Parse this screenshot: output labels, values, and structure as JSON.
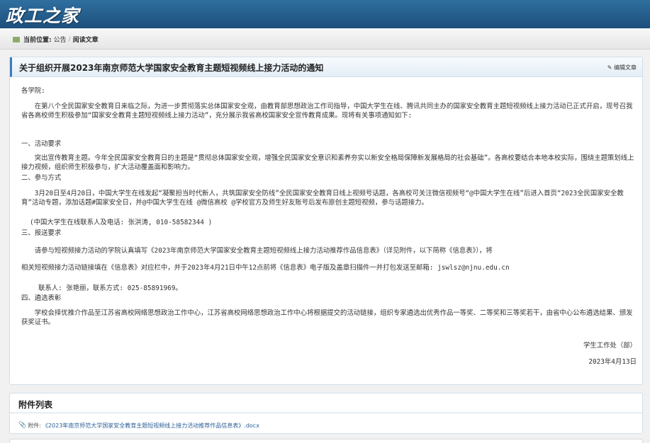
{
  "header": {
    "logo": "政工之家"
  },
  "breadcrumb": {
    "prefix": "当前位置:",
    "crumb1": "公告",
    "separator": "/",
    "crumb2": "阅读文章"
  },
  "article": {
    "title": "关于组织开展2023年南京师范大学国家安全教育主题短视频线上接力活动的通知",
    "edit_label": "编辑文章",
    "salutation": "各学院:",
    "intro": "在第八个全民国家安全教育日来临之际，为进一步贯彻落实总体国家安全观，由教育部思想政治工作司指导，中国大学生在线、腾讯共同主办的国家安全教育主题短视频线上接力活动已正式开启，现号召我省各高校师生积极参加“国家安全教育主题短视频线上接力活动”，充分展示我省高校国家安全宣传教育成果。现将有关事项通知如下:",
    "s1_title": "一、活动要求",
    "s1_body": "突出宣传教育主题。今年全民国家安全教育日的主题是“贯彻总体国家安全观，增强全民国家安全意识和素养夯实以新安全格局保障新发展格局的社会基础”。各高校要结合本地本校实际，围绕主题策划线上接力视频，组织师生积极参与，扩大活动覆盖面和影响力。",
    "s2_title": "二、参与方式",
    "s2_body": "3月20日至4月20日，中国大学生在线发起“凝聚担当时代新人，共筑国家安全防线”全民国家安全教育日线上视频号话题，各高校可关注微信视频号“@中国大学生在线”后进入首页“2023全民国家安全教育”活动专题，添加话题#国家安全日，并@中国大学生在线 @微信高校 @学校官方及师生好友账号后发布原创主题短视频，参与话题接力。",
    "s2_contact": "(中国大学生在线联系人及电话: 张洪涛, 010-58582344 )",
    "s3_title": "三、报送要求",
    "s3_body1": "请参与短视频接力活动的学院认真填写《2023年南京师范大学国家安全教育主题短视频线上接力活动推荐作品信息表》（详见附件，以下简称《信息表》），将",
    "s3_body2": "相关短视频接力活动链接填在《信息表》对应栏中，并于2023年4月21日中午12点前将《信息表》电子版及盖章扫描件一并打包发送至邮箱: jswlsz@njnu.edu.cn",
    "s3_contact": "联系人: 张艳丽，联系方式: 025-85891969。",
    "s4_title": "四、遴选表彰",
    "s4_body": "学校会择优推介作品至江苏省高校网络思想政治工作中心，江苏省高校网络思想政治工作中心将根据提交的活动链接，组织专家遴选出优秀作品一等奖、二等奖和三等奖若干，由省中心公布遴选结果、颁发获奖证书。",
    "signature": "学生工作处（部）",
    "date": "2023年4月13日"
  },
  "attachments": {
    "title": "附件列表",
    "prefix": "附件:",
    "file": "《2023年南京师范大学国家安全教育主题短视频线上接力活动推荐作品信息表》.docx"
  }
}
